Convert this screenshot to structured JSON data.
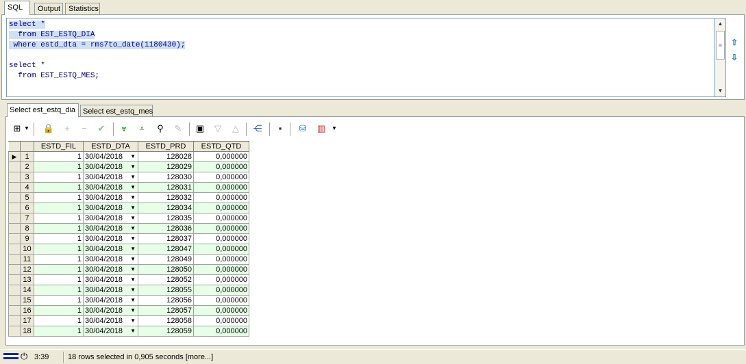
{
  "top_tabs": [
    "SQL",
    "Output",
    "Statistics"
  ],
  "editor": {
    "lines": [
      "select *",
      "  from EST_ESTQ_DIA",
      " where estd_dta = rms7to_date(1180430);",
      "",
      "select *",
      "  from EST_ESTQ_MES;"
    ]
  },
  "result_tabs": [
    "Select est_estq_dia",
    "Select est_estq_mes"
  ],
  "toolbar": {
    "icons": [
      "grid-icon",
      "lock-icon",
      "add-icon",
      "remove-icon",
      "check-icon",
      "fetch-next-icon",
      "fetch-last-icon",
      "find-icon",
      "clear-icon",
      "export-icon",
      "sort-down-icon",
      "sort-up-icon",
      "tree-icon",
      "save-icon",
      "database-icon",
      "chart-icon"
    ]
  },
  "grid": {
    "columns": [
      "ESTD_FIL",
      "ESTD_DTA",
      "ESTD_PRD",
      "ESTD_QTD"
    ],
    "rows": [
      {
        "n": "1",
        "fil": "1",
        "dta": "30/04/2018",
        "prd": "128028",
        "qtd": "0,000000"
      },
      {
        "n": "2",
        "fil": "1",
        "dta": "30/04/2018",
        "prd": "128029",
        "qtd": "0,000000"
      },
      {
        "n": "3",
        "fil": "1",
        "dta": "30/04/2018",
        "prd": "128030",
        "qtd": "0,000000"
      },
      {
        "n": "4",
        "fil": "1",
        "dta": "30/04/2018",
        "prd": "128031",
        "qtd": "0,000000"
      },
      {
        "n": "5",
        "fil": "1",
        "dta": "30/04/2018",
        "prd": "128032",
        "qtd": "0,000000"
      },
      {
        "n": "6",
        "fil": "1",
        "dta": "30/04/2018",
        "prd": "128034",
        "qtd": "0,000000"
      },
      {
        "n": "7",
        "fil": "1",
        "dta": "30/04/2018",
        "prd": "128035",
        "qtd": "0,000000"
      },
      {
        "n": "8",
        "fil": "1",
        "dta": "30/04/2018",
        "prd": "128036",
        "qtd": "0,000000"
      },
      {
        "n": "9",
        "fil": "1",
        "dta": "30/04/2018",
        "prd": "128037",
        "qtd": "0,000000"
      },
      {
        "n": "10",
        "fil": "1",
        "dta": "30/04/2018",
        "prd": "128047",
        "qtd": "0,000000"
      },
      {
        "n": "11",
        "fil": "1",
        "dta": "30/04/2018",
        "prd": "128049",
        "qtd": "0,000000"
      },
      {
        "n": "12",
        "fil": "1",
        "dta": "30/04/2018",
        "prd": "128050",
        "qtd": "0,000000"
      },
      {
        "n": "13",
        "fil": "1",
        "dta": "30/04/2018",
        "prd": "128052",
        "qtd": "0,000000"
      },
      {
        "n": "14",
        "fil": "1",
        "dta": "30/04/2018",
        "prd": "128055",
        "qtd": "0,000000"
      },
      {
        "n": "15",
        "fil": "1",
        "dta": "30/04/2018",
        "prd": "128056",
        "qtd": "0,000000"
      },
      {
        "n": "16",
        "fil": "1",
        "dta": "30/04/2018",
        "prd": "128057",
        "qtd": "0,000000"
      },
      {
        "n": "17",
        "fil": "1",
        "dta": "30/04/2018",
        "prd": "128058",
        "qtd": "0,000000"
      },
      {
        "n": "18",
        "fil": "1",
        "dta": "30/04/2018",
        "prd": "128059",
        "qtd": "0,000000"
      }
    ]
  },
  "status": {
    "time": "3:39",
    "message": "18 rows selected in 0,905 seconds [more...]"
  },
  "colors": {
    "keyword": "#000080",
    "selection": "#cfe0f7",
    "alt_row": "#e6ffe6"
  }
}
